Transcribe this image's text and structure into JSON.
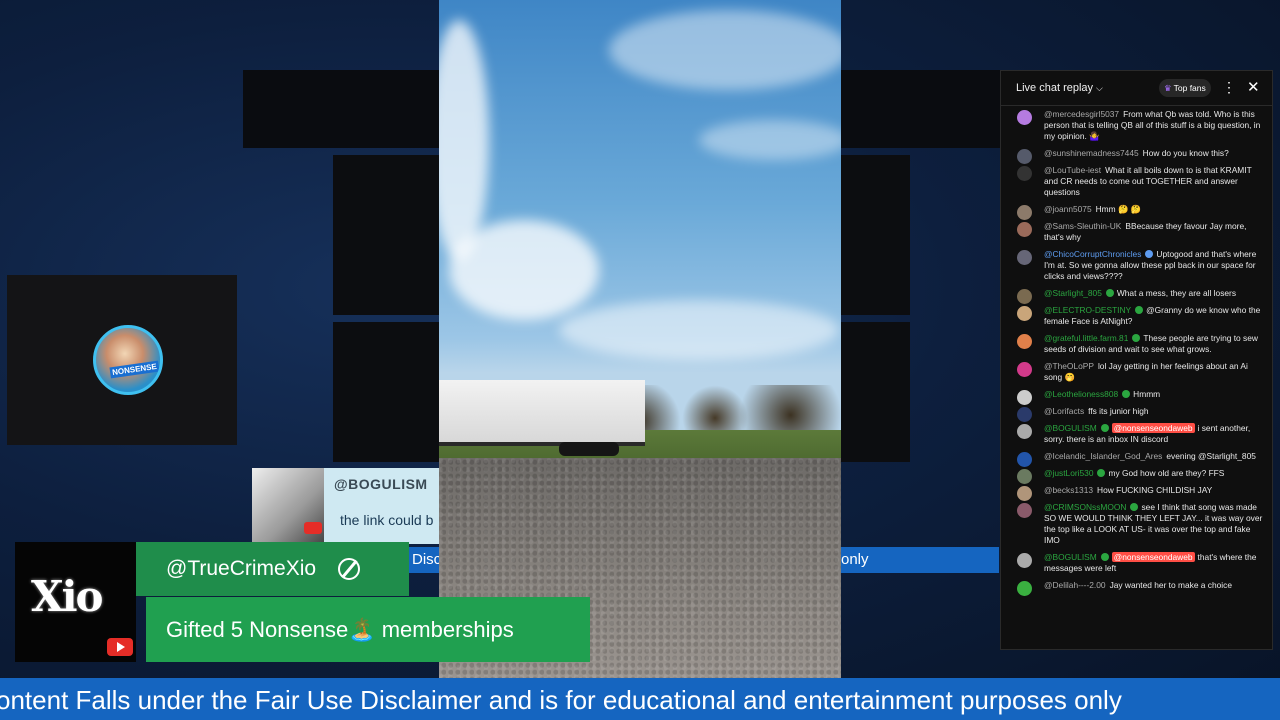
{
  "chat": {
    "title": "Live chat replay",
    "top_fans_label": "Top fans",
    "messages": [
      {
        "user": "@mercedesgirl5037",
        "text": "From what Qb was told. Who is this person that is telling QB all of this stuff is a big question, in my opinion. 🤷‍♀️",
        "color": "gray",
        "avatar": "#b57be0"
      },
      {
        "user": "@sunshinemadness7445",
        "text": "How do you know this?",
        "color": "gray",
        "avatar": "#555a6a"
      },
      {
        "user": "@LouTube-iest",
        "text": "What it all boils down to is that KRAMIT and CR needs to come out TOGETHER and answer questions",
        "color": "gray",
        "avatar": "#333"
      },
      {
        "user": "@joann5075",
        "text": "Hmm 🤔 🤔",
        "color": "gray",
        "avatar": "#8c7a6a"
      },
      {
        "user": "@Sams-Sleuthin-UK",
        "text": "BBecause they favour Jay more, that's why",
        "color": "gray",
        "avatar": "#9a6a5a"
      },
      {
        "user": "@ChicoCorruptChronicles",
        "text": "Uptogood and that's where I'm at. So we gonna allow these ppl back in our space for clicks and views????",
        "color": "blue",
        "avatar": "#667"
      },
      {
        "user": "@Starlight_805",
        "text": "What a mess, they are all losers",
        "color": "green",
        "avatar": "#7a6a50"
      },
      {
        "user": "@ELECTRO-DESTINY",
        "text": "@Granny do we know who the female Face is AtNight?",
        "color": "green",
        "avatar": "#c9a57a"
      },
      {
        "user": "@grateful.little.farm.81",
        "text": "These people are trying to sew seeds of division and wait to see what grows.",
        "color": "green",
        "avatar": "#e0804a"
      },
      {
        "user": "@TheOLoPP",
        "text": "lol Jay getting in her feelings about an Ai song 🤭",
        "color": "gray",
        "avatar": "#d23a8a"
      },
      {
        "user": "@Leothelioness808",
        "text": "Hmmm",
        "color": "green",
        "avatar": "#ccc"
      },
      {
        "user": "@Lorifacts",
        "text": "ffs its junior high",
        "color": "gray",
        "avatar": "#2a3a6a"
      },
      {
        "user": "@BOGULISM",
        "mention": "@nonsenseondaweb",
        "text": "i sent another, sorry. there is an inbox IN discord",
        "color": "green",
        "avatar": "#aaa"
      },
      {
        "user": "@Icelandic_Islander_God_Ares",
        "text": "evening @Starlight_805",
        "color": "gray",
        "avatar": "#2255aa"
      },
      {
        "user": "@justLori530",
        "text": "my God how old are they? FFS",
        "color": "green",
        "avatar": "#6a7a60"
      },
      {
        "user": "@becks1313",
        "text": "How FUCKING CHILDISH JAY",
        "color": "gray",
        "avatar": "#b0957a"
      },
      {
        "user": "@CRIMSONssMOON",
        "text": "see I think that song was made SO WE WOULD THINK THEY LEFT JAY... it was way over the top like a LOOK AT US- it was over the top and fake IMO",
        "color": "green",
        "avatar": "#8a5a6a"
      },
      {
        "user": "@BOGULISM",
        "mention": "@nonsenseondaweb",
        "text": "that's where the messages were left",
        "color": "green",
        "avatar": "#aaa"
      },
      {
        "user": "@Delilah----2.00",
        "text": "Jay wanted her to make a choice",
        "color": "gray",
        "avatar": "#3ab040"
      }
    ]
  },
  "comment_card": {
    "user": "@BOGULISM",
    "text": "the link could b"
  },
  "gift": {
    "logo": "Xio",
    "user": "@TrueCrimeXio",
    "message": "Gifted 5 Nonsense🏝️ memberships"
  },
  "strip_left": "Discla",
  "strip_right": "only",
  "avatar_tag": "NONSENSE",
  "ticker": "ontent Falls under the Fair Use Disclaimer and is for educational and entertainment purposes only",
  "colors": {
    "green": "#1f8d4b",
    "ticker_blue": "#1565c0",
    "chat_bg": "#0f0f0f"
  }
}
